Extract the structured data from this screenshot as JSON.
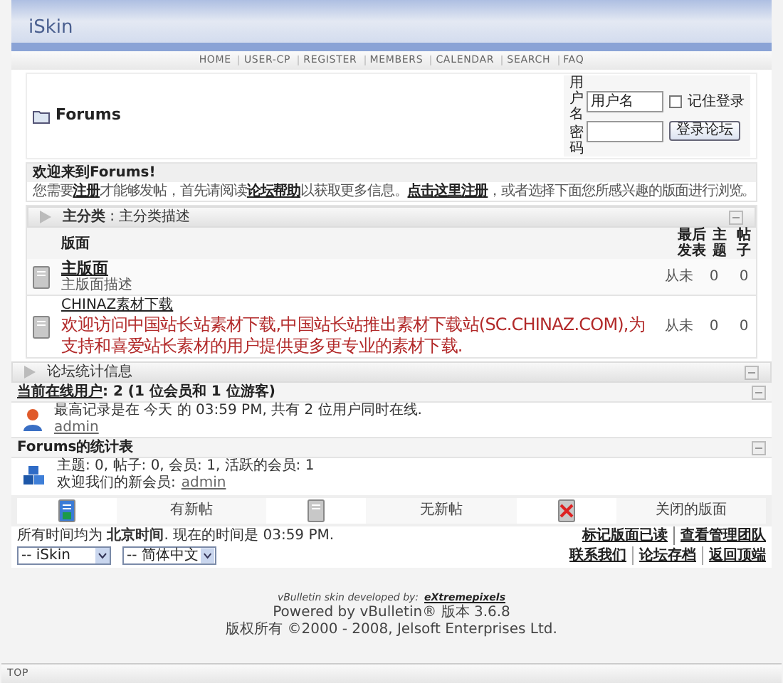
{
  "header": {
    "logo": "iSkin"
  },
  "nav": [
    "HOME",
    "USER-CP",
    "REGISTER",
    "MEMBERS",
    "CALENDAR",
    "SEARCH",
    "FAQ"
  ],
  "title": "Forums",
  "login": {
    "username_label": "用户名",
    "username_value": "用户名",
    "password_label": "密码",
    "remember_label": "记住登录",
    "remember_checked": false,
    "button": "登录论坛"
  },
  "welcome": {
    "heading": "欢迎来到Forums!",
    "parts": [
      {
        "kind": "text",
        "text": "您需要"
      },
      {
        "kind": "link",
        "text": "注册"
      },
      {
        "kind": "text",
        "text": "才能够发帖，首先请阅读"
      },
      {
        "kind": "link",
        "text": "论坛帮助"
      },
      {
        "kind": "text",
        "text": "以获取更多信息。"
      },
      {
        "kind": "link",
        "text": "点击这里注册"
      },
      {
        "kind": "text",
        "text": "，或者选择下面您所感兴趣的版面进行浏览。"
      }
    ]
  },
  "category": {
    "title": "**主分类** : 主分类描述"
  },
  "columns": [
    "版面",
    "最后发表",
    "主题",
    "帖子"
  ],
  "forums": [
    {
      "kind": "normal",
      "name": "主版面",
      "description": "主版面描述",
      "last_post": "从未",
      "threads": "0",
      "posts": "0"
    },
    {
      "kind": "promo",
      "name": "CHINAZ素材下载",
      "description": "欢迎访问中国站长站素材下载,中国站长站推出素材下载站(SC.CHINAZ.COM),为支持和喜爱站长素材的用户提供更多更专业的素材下载.",
      "last_post": "从未",
      "threads": "0",
      "posts": "0"
    }
  ],
  "stats_bar": "论坛统计信息",
  "online": {
    "heading_link": "当前在线用户",
    "heading_rest": ": 2 (1 位会员和 1 位游客)",
    "record": "最高记录是在 今天 的 03:59 PM, 共有 2 位用户同时在线.",
    "users": [
      "admin"
    ]
  },
  "stats": {
    "heading": "Forums的统计表",
    "line": "主题: 0, 帖子: 0, 会员: 1, 活跃的会员: 1",
    "newest_label": "欢迎我们的新会员:",
    "newest": "admin"
  },
  "legend": [
    {
      "kind": "new",
      "label": "有新帖"
    },
    {
      "kind": "none",
      "label": "无新帖"
    },
    {
      "kind": "closed",
      "label": "关闭的版面"
    }
  ],
  "time": "所有时间均为 **北京时间**. 现在的时间是 03:59 PM.",
  "top_links": [
    "标记版面已读",
    "查看管理团队"
  ],
  "selects": [
    "-- iSkin",
    "-- 简体中文"
  ],
  "bottom_links": [
    "联系我们",
    "论坛存档",
    "返回顶端"
  ],
  "footer": {
    "credit_label": "vBulletin skin developed by:",
    "credit_link": "eXtremepixels",
    "powered": "Powered by vBulletin® 版本 3.6.8",
    "copyright": "版权所有 ©2000 - 2008, Jelsoft Enterprises Ltd."
  },
  "top": "TOP"
}
